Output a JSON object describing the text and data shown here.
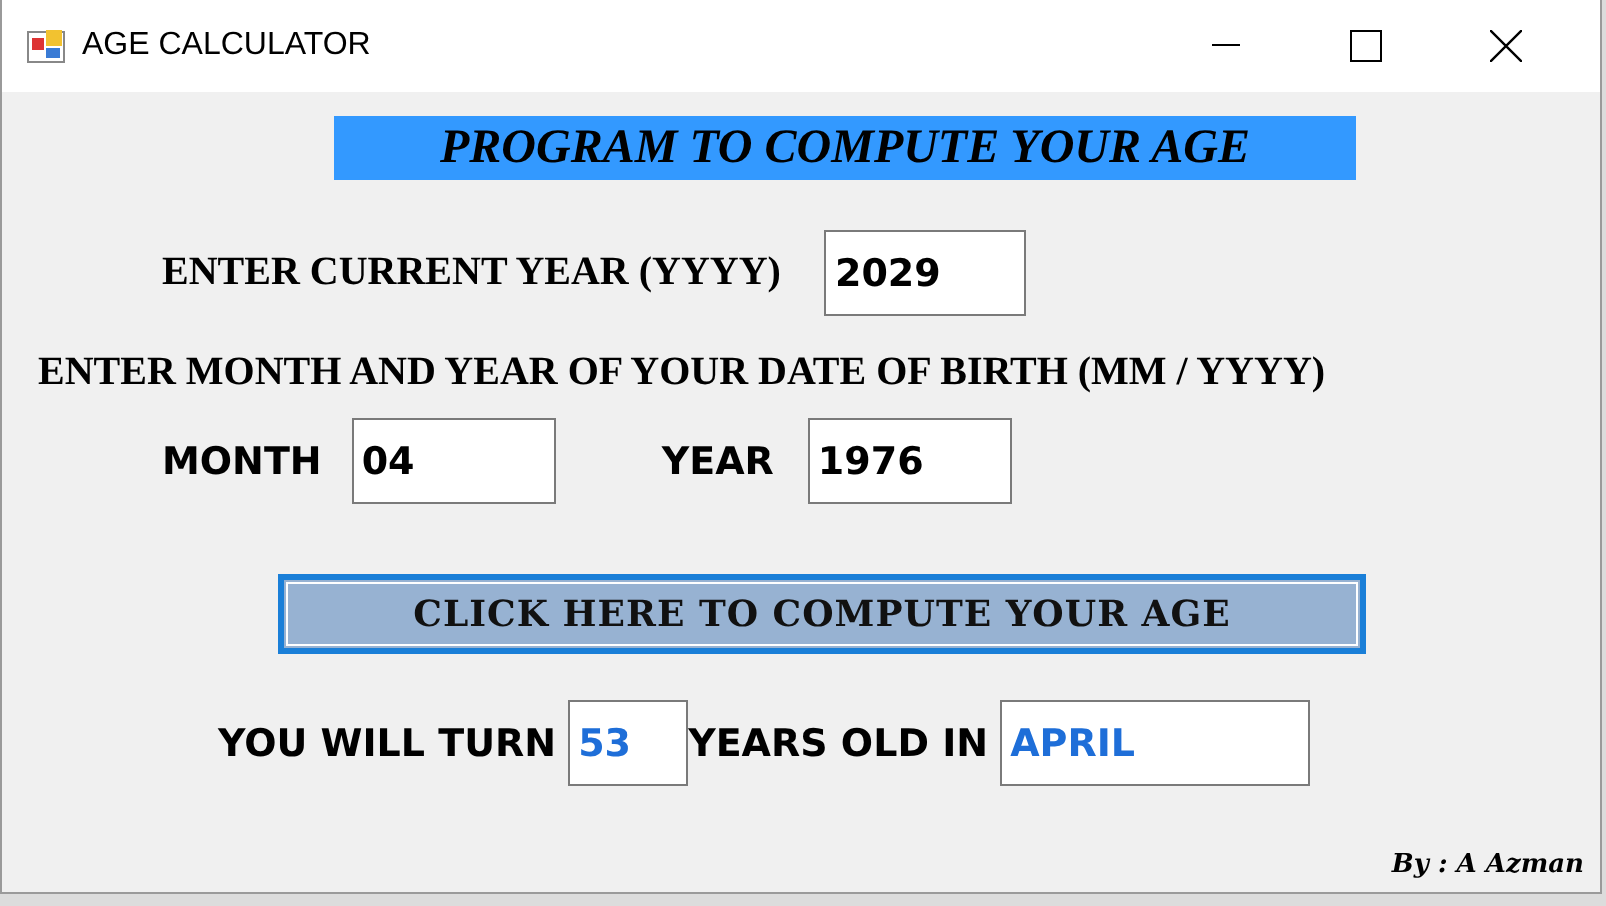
{
  "window": {
    "title": "AGE CALCULATOR"
  },
  "heading": "PROGRAM TO COMPUTE YOUR AGE",
  "current_year": {
    "label": "ENTER CURRENT YEAR (YYYY)",
    "value": "2029"
  },
  "birth_label": "ENTER MONTH AND YEAR OF YOUR DATE OF BIRTH (MM / YYYY)",
  "month": {
    "label": "MONTH",
    "value": "04"
  },
  "year": {
    "label": "YEAR",
    "value": "1976"
  },
  "compute_button": "CLICK HERE TO COMPUTE YOUR AGE",
  "result": {
    "prefix": "YOU WILL TURN",
    "age": "53",
    "middle": "YEARS OLD IN",
    "month": "APRIL"
  },
  "credit": "By : A Azman"
}
